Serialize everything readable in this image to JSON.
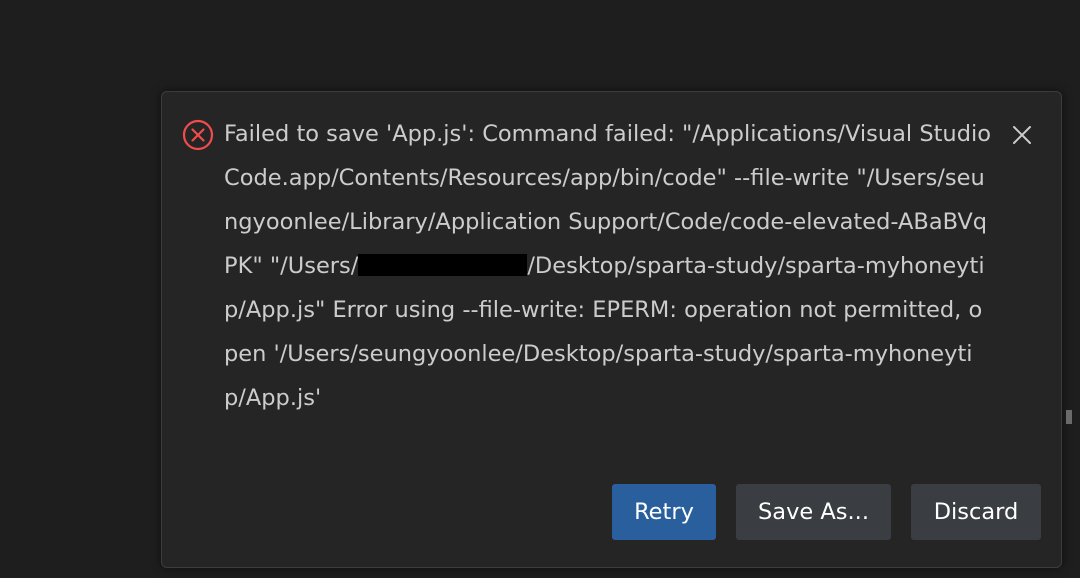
{
  "notification": {
    "message_part1": "Failed to save 'App.js': Command failed: \"/Applications/Visual Studio Code.app/Contents/Resources/app/bin/code\" --file-write \"/Users/seungyoonlee/Library/Application Support/Code/code-elevated-ABaBVqPK\" \"/Users/",
    "message_part2": "/Desktop/sparta-study/sparta-myhoneytip/App.js\" Error using --file-write: EPERM: operation not permitted, open '/Users/seungyoonlee/Desktop/sparta-study/sparta-myhoneytip/App.js'",
    "icons": {
      "status": "error-circle-x-icon",
      "close": "close-x-icon"
    },
    "colors": {
      "error": "#f14c4c",
      "primary_button": "#2a5f9e",
      "secondary_button": "#3a3d41"
    }
  },
  "buttons": {
    "retry": "Retry",
    "save_as": "Save As...",
    "discard": "Discard"
  }
}
